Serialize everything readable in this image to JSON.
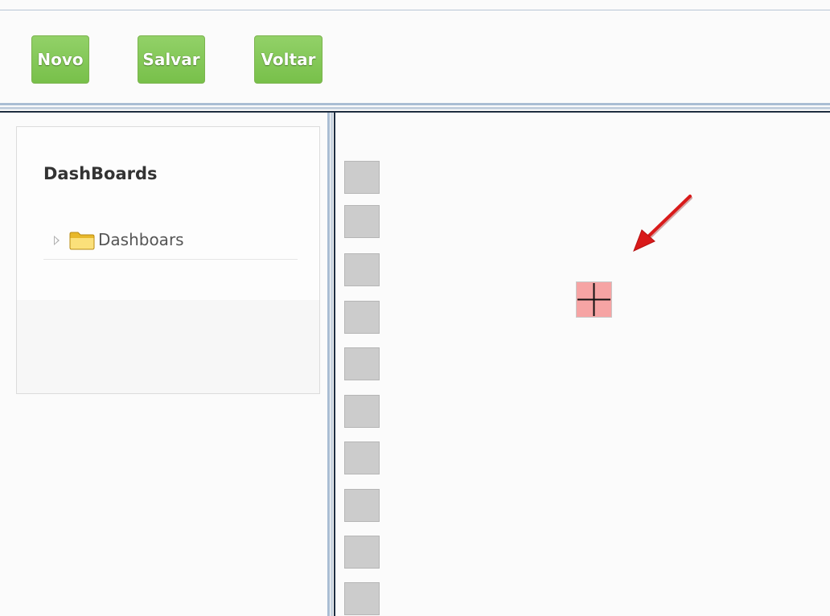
{
  "toolbar": {
    "new_label": "Novo",
    "save_label": "Salvar",
    "back_label": "Voltar"
  },
  "sidebar": {
    "title": "DashBoards",
    "tree": [
      {
        "label": "Dashboars",
        "icon": "folder-icon",
        "expanded": false
      }
    ]
  },
  "canvas": {
    "palette_item_count": 10,
    "drop_target_icon": "plus-icon",
    "annotation_icon": "red-arrow-icon"
  },
  "colors": {
    "button_green": "#78c04a",
    "drop_target_fill": "#f6a4a4",
    "palette_gray": "#cccccc",
    "arrow_red": "#d91a1a"
  }
}
